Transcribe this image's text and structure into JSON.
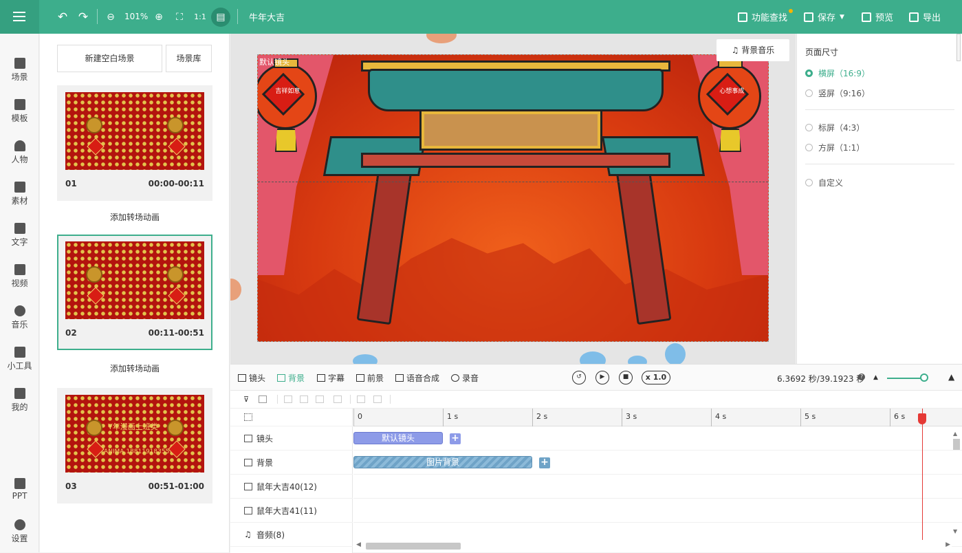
{
  "topbar": {
    "zoom": "101%",
    "title": "牛年大吉",
    "func_search": "功能查找",
    "save": "保存",
    "preview": "预览",
    "export": "导出"
  },
  "nav": [
    {
      "label": "场景",
      "icon": "scene-icon"
    },
    {
      "label": "模板",
      "icon": "template-icon"
    },
    {
      "label": "人物",
      "icon": "person-icon"
    },
    {
      "label": "素材",
      "icon": "material-icon"
    },
    {
      "label": "文字",
      "icon": "text-icon"
    },
    {
      "label": "视频",
      "icon": "video-icon"
    },
    {
      "label": "音乐",
      "icon": "music-icon"
    },
    {
      "label": "小工具",
      "icon": "toolbox-icon"
    },
    {
      "label": "我的",
      "icon": "upload-icon"
    },
    {
      "label": "PPT",
      "icon": "ppt-icon"
    },
    {
      "label": "设置",
      "icon": "settings-icon"
    }
  ],
  "scenes": {
    "new_blank": "新建空白场景",
    "library": "场景库",
    "add_transition": "添加转场动画",
    "items": [
      {
        "num": "01",
        "time": "00:00-00:11"
      },
      {
        "num": "02",
        "time": "00:11-00:51"
      },
      {
        "num": "03",
        "time": "00:51-01:00",
        "overlay_title": "Y年漫画上班类",
        "overlay_sub": "ANIMA 18811918355"
      }
    ]
  },
  "canvas": {
    "default_lens_label": "默认镜头",
    "bgm_button": "背景音乐",
    "lantern_left": "吉祥如意",
    "lantern_right": "心想事成"
  },
  "page_size": {
    "title": "页面尺寸",
    "options": [
      "横屏（16:9）",
      "竖屏（9:16）",
      "标屏（4:3）",
      "方屏（1:1）",
      "自定义"
    ],
    "selected": "横屏（16:9）"
  },
  "timeline": {
    "tabs": [
      "镜头",
      "背景",
      "字幕",
      "前景",
      "语音合成",
      "录音"
    ],
    "active_tab": "背景",
    "speed": "x 1.0",
    "time_readout": "6.3692 秒/39.1923 秒",
    "ruler": [
      "0",
      "1 s",
      "2 s",
      "3 s",
      "4 s",
      "5 s",
      "6 s"
    ],
    "tracks": [
      "镜头",
      "背景",
      "鼠年大吉40(12)",
      "鼠年大吉41(11)",
      "音频(8)"
    ],
    "clip_lens": "默认镜头",
    "clip_bg": "图片背景",
    "add": "+"
  },
  "colors": {
    "brand": "#3dae8c",
    "playhead": "#e53935",
    "lens_clip": "#8d9be8",
    "bg_clip": "#6fa3c7"
  }
}
